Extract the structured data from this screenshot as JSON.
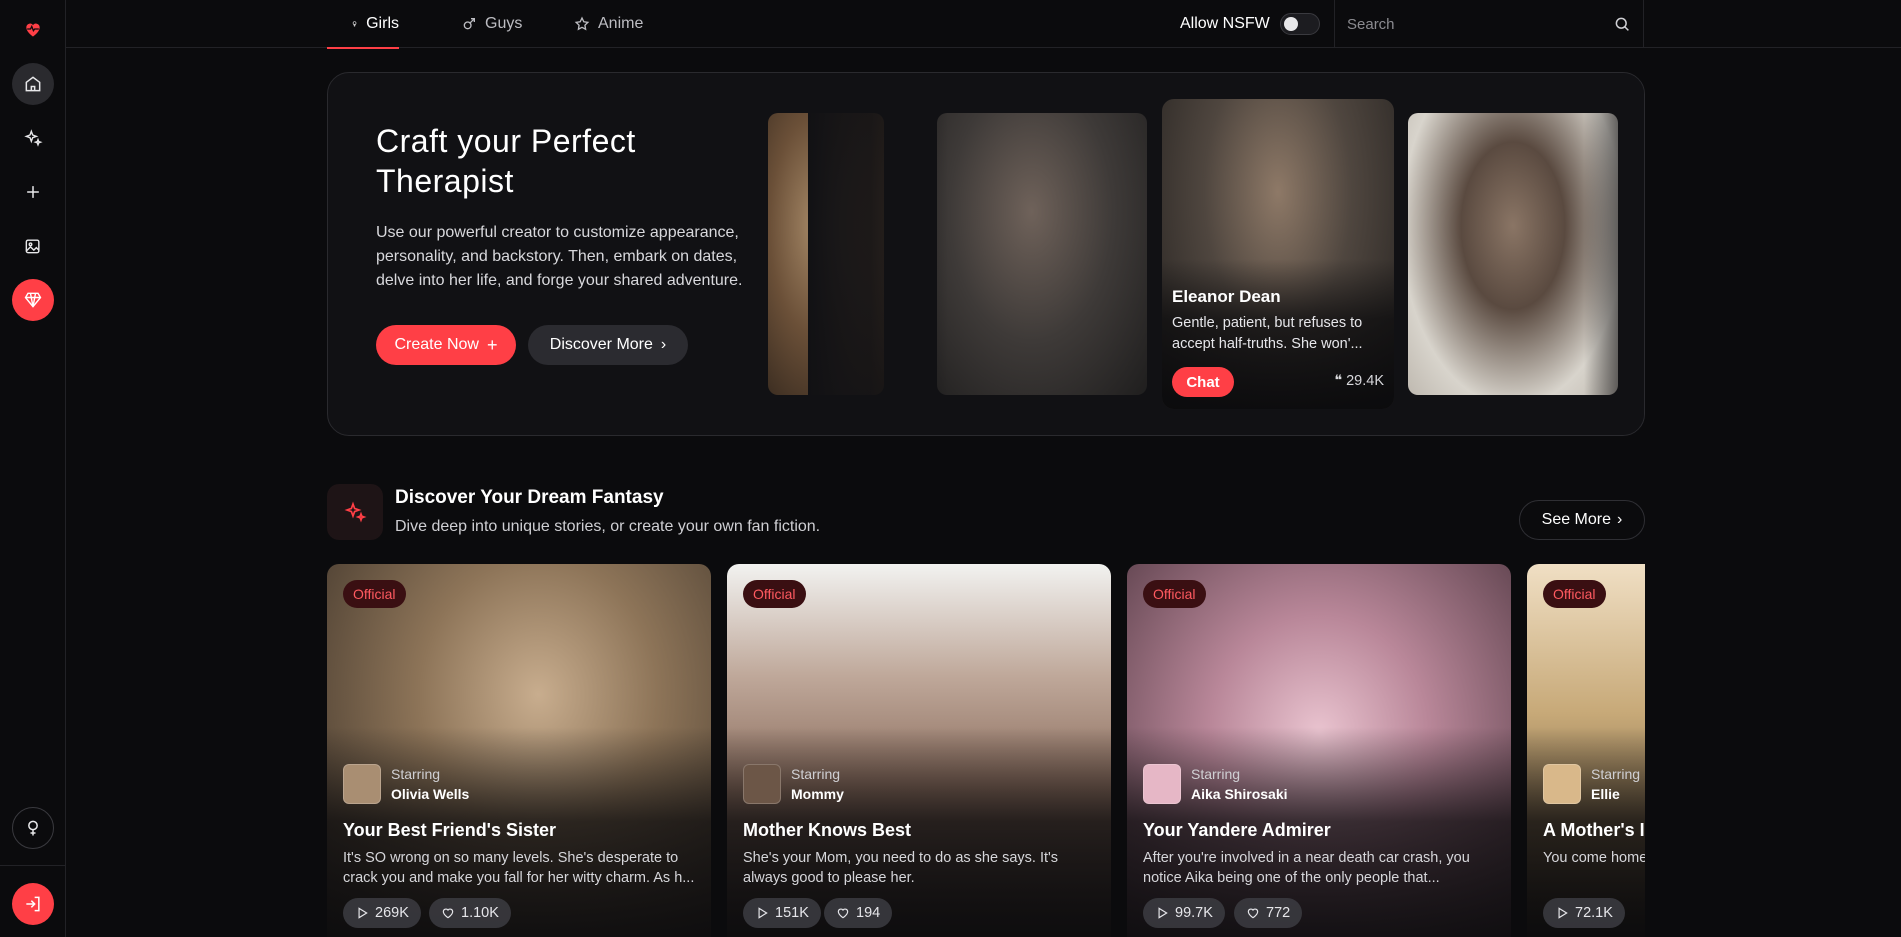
{
  "nav": {
    "tabs": [
      {
        "label": "Girls",
        "icon": "female-icon",
        "active": true
      },
      {
        "label": "Guys",
        "icon": "male-icon",
        "active": false
      },
      {
        "label": "Anime",
        "icon": "star-icon",
        "active": false
      }
    ],
    "nsfw_label": "Allow NSFW",
    "nsfw_enabled": false,
    "search_placeholder": "Search"
  },
  "sidebar": {
    "items": [
      "logo-heart-icon",
      "home-icon",
      "sparkles-icon",
      "plus-icon",
      "image-edit-icon",
      "diamond-icon",
      "gender-icon",
      "login-icon"
    ]
  },
  "hero": {
    "title": "Craft your Perfect Therapist",
    "text": "Use our powerful creator to customize appearance, personality, and backstory. Then, embark on dates, delve into her life, and forge your shared adventure.",
    "create_label": "Create Now",
    "discover_label": "Discover More",
    "featured": {
      "name": "Eleanor Dean",
      "description": "Gentle, patient, but refuses to accept half-truths. She won'...",
      "chat_label": "Chat",
      "chat_count": "29.4K"
    }
  },
  "section": {
    "title": "Discover Your Dream Fantasy",
    "subtitle": "Dive deep into unique stories, or create your own fan fiction.",
    "see_more_label": "See More",
    "starring_label": "Starring",
    "stories": [
      {
        "badge": "Official",
        "star": "Olivia Wells",
        "title": "Your Best Friend's Sister",
        "desc": "It's SO wrong on so many levels. She's desperate to crack you and make you fall for her witty charm. As h...",
        "plays": "269K",
        "likes": "1.10K"
      },
      {
        "badge": "Official",
        "star": "Mommy",
        "title": "Mother Knows Best",
        "desc": "She's your Mom, you need to do as she says. It's always good to please her.",
        "plays": "151K",
        "likes": "194"
      },
      {
        "badge": "Official",
        "star": "Aika Shirosaki",
        "title": "Your Yandere Admirer",
        "desc": "After you're involved in a near death car crash, you notice Aika being one of the only people that...",
        "plays": "99.7K",
        "likes": "772"
      },
      {
        "badge": "Official",
        "star": "Ellie",
        "title": "A Mother's In",
        "desc": "You come home chaos of the day",
        "plays": "72.1K",
        "likes": ""
      }
    ]
  },
  "colors": {
    "accent": "#ff3f46",
    "background": "#0b0b0d"
  }
}
